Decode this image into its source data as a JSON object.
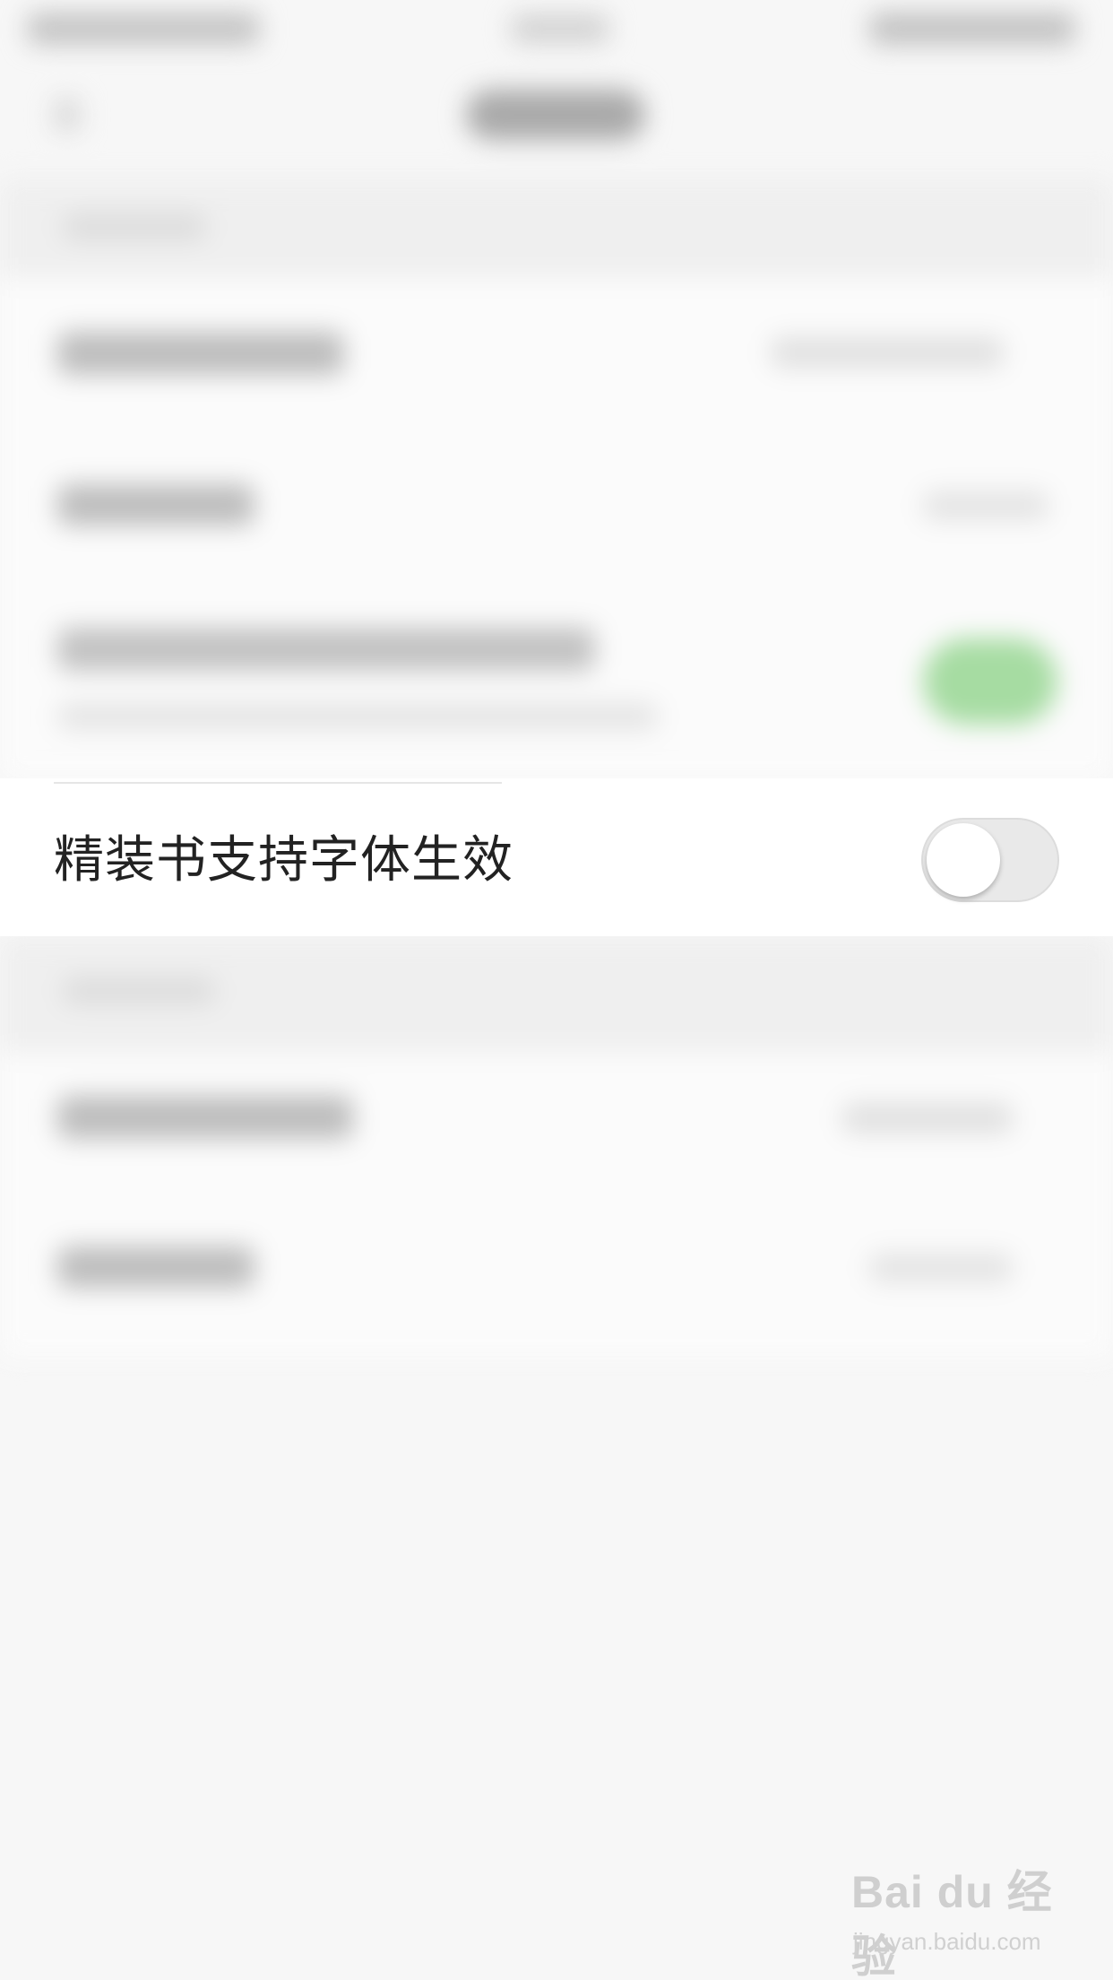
{
  "setting_row": {
    "label": "精装书支持字体生效",
    "toggle_state": "off"
  },
  "watermark": {
    "logo_text": "Bai du 经验",
    "url_text": "jingyan.baidu.com"
  },
  "colors": {
    "background": "#f7f7f7",
    "row_background": "#ffffff",
    "label_text": "#222222",
    "toggle_track_off": "#e9e9e9",
    "toggle_knob": "#ffffff",
    "blurred_toggle_on": "#8fd18b"
  }
}
